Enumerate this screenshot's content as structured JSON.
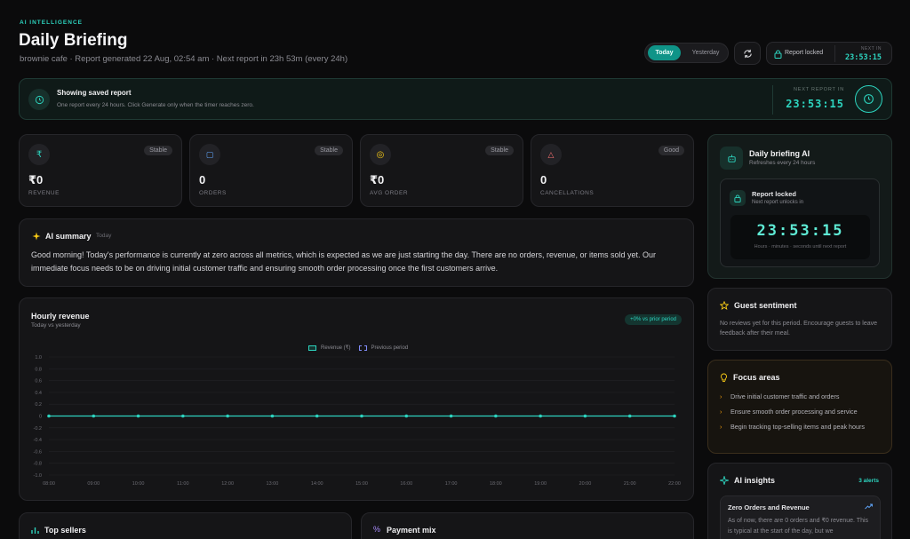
{
  "header": {
    "eyebrow": "AI INTELLIGENCE",
    "title": "Daily Briefing",
    "subtitle": "brownie cafe · Report generated 22 Aug, 02:54 am · Next report in 23h 53m (every 24h)",
    "toggle": {
      "today": "Today",
      "yesterday": "Yesterday"
    },
    "lock_label": "Report locked",
    "next_in_label": "NEXT IN",
    "next_in_timer": "23:53:15"
  },
  "banner": {
    "title": "Showing saved report",
    "desc": "One report every 24 hours. Click Generate only when the timer reaches zero.",
    "next_label": "NEXT REPORT IN",
    "timer": "23:53:15"
  },
  "stats": [
    {
      "value": "₹0",
      "label": "REVENUE",
      "badge": "Stable",
      "icon_color": "#2dd4bf",
      "glyph": "₹"
    },
    {
      "value": "0",
      "label": "ORDERS",
      "badge": "Stable",
      "icon_color": "#60a5fa",
      "glyph": "▢"
    },
    {
      "value": "₹0",
      "label": "AVG ORDER",
      "badge": "Stable",
      "icon_color": "#facc15",
      "glyph": "◎"
    },
    {
      "value": "0",
      "label": "CANCELLATIONS",
      "badge": "Good",
      "icon_color": "#f87171",
      "glyph": "△"
    }
  ],
  "summary": {
    "title": "AI summary",
    "tag": "Today",
    "text": "Good morning! Today's performance is currently at zero across all metrics, which is expected as we are just starting the day. There are no orders, revenue, or items sold yet. Our immediate focus needs to be on driving initial customer traffic and ensuring smooth order processing once the first customers arrive."
  },
  "hourly": {
    "title": "Hourly revenue",
    "subtitle": "Today vs yesterday",
    "delta_badge": "+0% vs prior period"
  },
  "chart_data": {
    "type": "line",
    "title": "Hourly revenue",
    "subtitle": "Today vs yesterday",
    "x": [
      "08:00",
      "09:00",
      "10:00",
      "11:00",
      "12:00",
      "13:00",
      "14:00",
      "15:00",
      "16:00",
      "17:00",
      "18:00",
      "19:00",
      "20:00",
      "21:00",
      "22:00"
    ],
    "y_ticks": [
      "1.0",
      "0.8",
      "0.6",
      "0.4",
      "0.2",
      "0",
      "-0.2",
      "-0.4",
      "-0.6",
      "-0.8",
      "-1.0"
    ],
    "ylim": [
      -1.0,
      1.0
    ],
    "series": [
      {
        "name": "Revenue (₹)",
        "values": [
          0,
          0,
          0,
          0,
          0,
          0,
          0,
          0,
          0,
          0,
          0,
          0,
          0,
          0,
          0
        ],
        "color": "#2dd4bf"
      },
      {
        "name": "Previous period",
        "values": [
          0,
          0,
          0,
          0,
          0,
          0,
          0,
          0,
          0,
          0,
          0,
          0,
          0,
          0,
          0
        ],
        "color": "#818cf8"
      }
    ],
    "legend": "top-center",
    "grid": true
  },
  "bottom": {
    "top_sellers": "Top sellers",
    "payment_mix": "Payment mix"
  },
  "ai_panel": {
    "title": "Daily briefing AI",
    "subtitle": "Refreshes every 24 hours",
    "lock_title": "Report locked",
    "lock_sub": "Next report unlocks in",
    "timer": "23:53:15",
    "timer_caption": "Hours · minutes · seconds until next report"
  },
  "sentiment": {
    "title": "Guest sentiment",
    "text": "No reviews yet for this period. Encourage guests to leave feedback after their meal."
  },
  "focus": {
    "title": "Focus areas",
    "items": [
      "Drive initial customer traffic and orders",
      "Ensure smooth order processing and service",
      "Begin tracking top-selling items and peak hours"
    ]
  },
  "insights": {
    "title": "AI insights",
    "count": "3 alerts",
    "card_title": "Zero Orders and Revenue",
    "card_text": "As of now, there are 0 orders and ₹0 revenue. This is typical at the start of the day, but we"
  },
  "colors": {
    "accent": "#2dd4bf",
    "background": "#0b0b0c",
    "card": "#151517"
  }
}
